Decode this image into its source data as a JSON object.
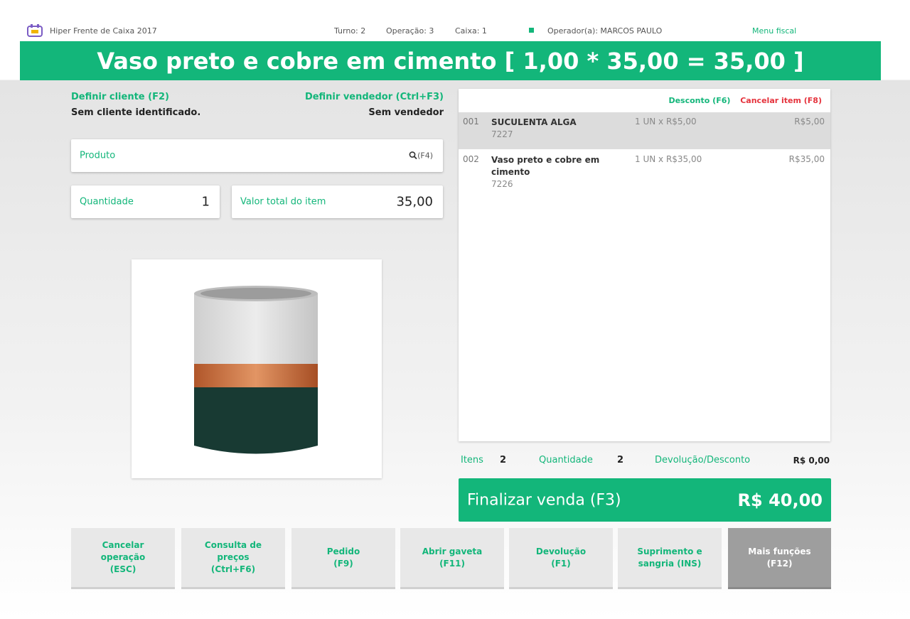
{
  "topbar": {
    "app_name": "Hiper Frente de Caixa 2017",
    "turno": "Turno: 2",
    "operacao": "Operação: 3",
    "caixa": "Caixa: 1",
    "operador": "Operador(a): MARCOS PAULO",
    "menu": "Menu fiscal"
  },
  "banner": {
    "text": "Vaso preto e cobre em cimento [ 1,00 * 35,00 = 35,00 ]"
  },
  "client": {
    "link": "Definir cliente (F2)",
    "value": "Sem cliente identificado."
  },
  "seller": {
    "link": "Definir vendedor (Ctrl+F3)",
    "value": "Sem vendedor"
  },
  "product": {
    "label": "Produto",
    "search_hint": "(F4)"
  },
  "quantity": {
    "label": "Quantidade",
    "value": "1"
  },
  "item_total": {
    "label": "Valor total do item",
    "value": "35,00"
  },
  "list": {
    "discount_action": "Desconto (F6)",
    "cancel_action": "Cancelar item (F8)",
    "items": [
      {
        "num": "001",
        "name": "SUCULENTA ALGA",
        "code": "7227",
        "qty": "1 UN x R$5,00",
        "total": "R$5,00"
      },
      {
        "num": "002",
        "name": "Vaso preto e cobre em cimento",
        "code": "7226",
        "qty": "1 UN x R$35,00",
        "total": "R$35,00"
      }
    ]
  },
  "summary": {
    "items_label": "Itens",
    "items_value": "2",
    "qty_label": "Quantidade",
    "qty_value": "2",
    "refund_label": "Devolução/Desconto",
    "refund_value": "R$ 0,00"
  },
  "finalize": {
    "label": "Finalizar venda (F3)",
    "amount": "R$ 40,00"
  },
  "buttons": {
    "cancel": "Cancelar operação (ESC)",
    "prices": "Consulta de preços (Ctrl+F6)",
    "order": "Pedido (F9)",
    "drawer": "Abrir gaveta (F11)",
    "refund": "Devolução (F1)",
    "supply": "Suprimento e sangria (INS)",
    "more": "Mais funções (F12)"
  },
  "colors": {
    "accent": "#13b67a",
    "danger": "#e5323c"
  }
}
